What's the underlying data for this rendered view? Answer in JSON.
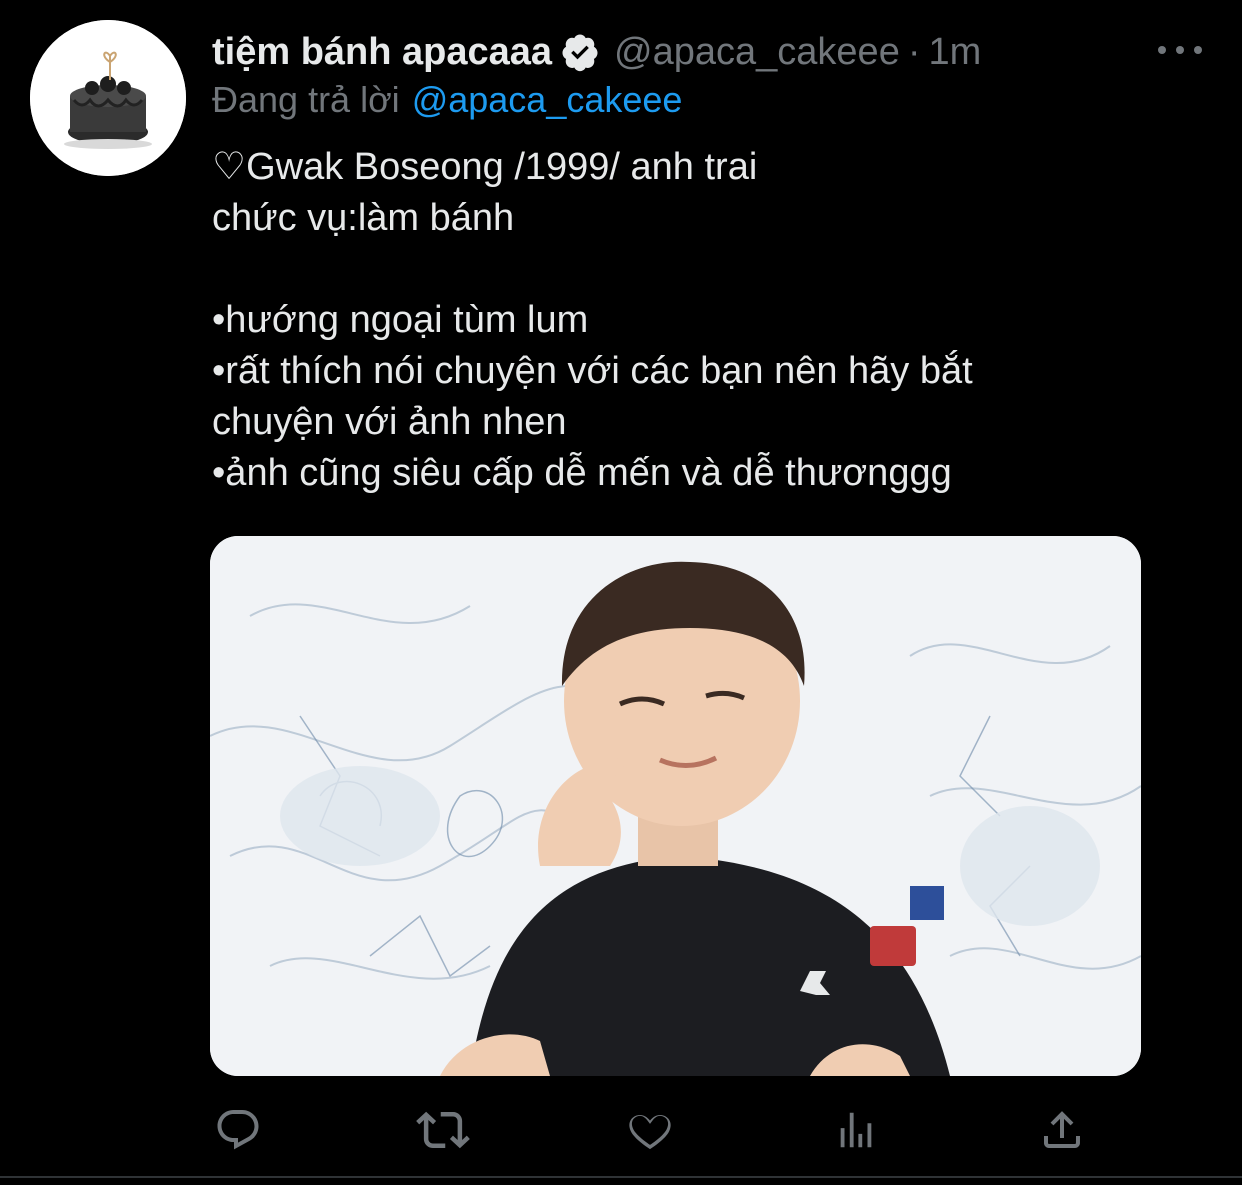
{
  "tweet": {
    "display_name": "tiệm bánh apacaaa",
    "handle": "@apaca_cakeee",
    "separator": "·",
    "time": "1m",
    "reply_prefix": "Đang trả lời",
    "reply_to": "@apaca_cakeee",
    "text_lines": [
      "♡Gwak Boseong /1999/ anh trai",
      "chức vụ:làm bánh",
      "",
      "•hướng ngoại tùm lum",
      "•rất thích nói chuyện với các bạn nên hãy bắt",
      "chuyện với ảnh nhen",
      "•ảnh cũng siêu cấp dễ mến và dễ thươnggg"
    ]
  },
  "icons": {
    "verified": "verified-badge-icon",
    "more": "more-options-icon",
    "reply": "reply-icon",
    "retweet": "retweet-icon",
    "like": "heart-icon",
    "analytics": "analytics-icon",
    "share": "share-icon"
  },
  "colors": {
    "background": "#000000",
    "text": "#e7e9ea",
    "muted": "#71767b",
    "link": "#1d9bf0"
  }
}
